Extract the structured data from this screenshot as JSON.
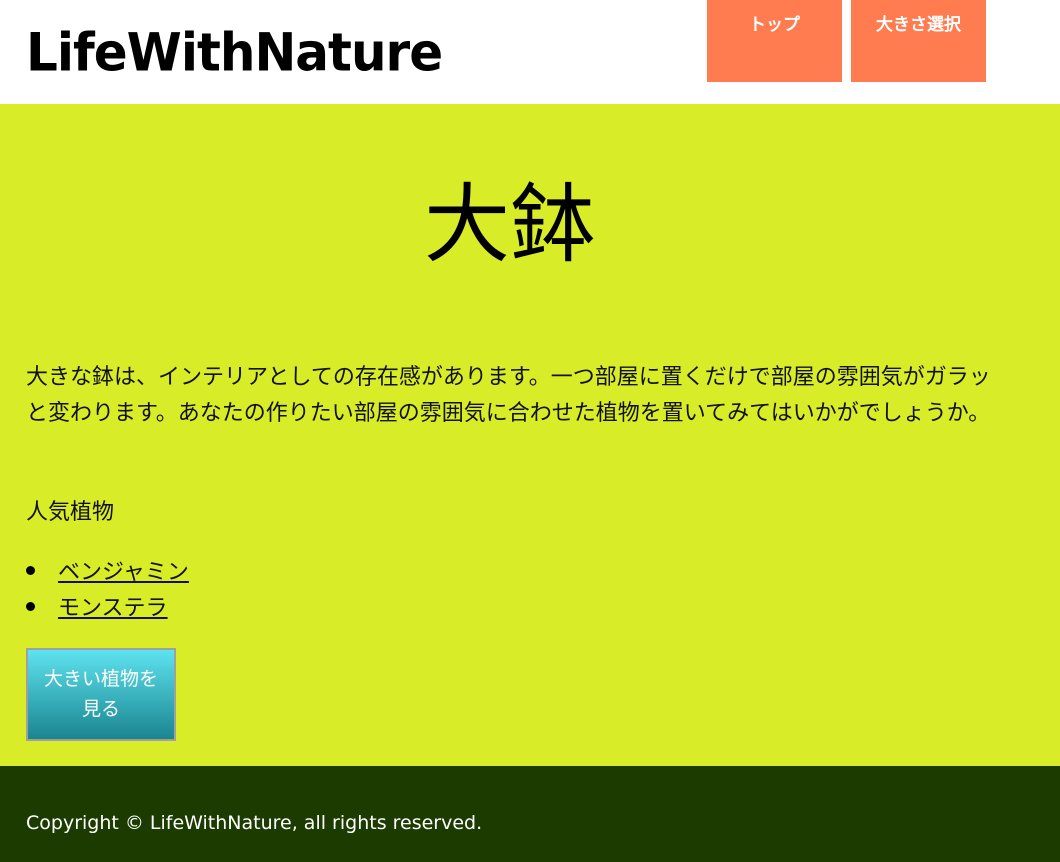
{
  "header": {
    "logo": "LifeWithNature",
    "nav": [
      {
        "label": "トップ"
      },
      {
        "label": "大きさ選択"
      }
    ]
  },
  "main": {
    "title": "大鉢",
    "description": "大きな鉢は、インテリアとしての存在感があります。一つ部屋に置くだけで部屋の雰囲気がガラッと変わります。あなたの作りたい部屋の雰囲気に合わせた植物を置いてみてはいかがでしょうか。",
    "popular_label": "人気植物",
    "plants": [
      {
        "name": "ベンジャミン"
      },
      {
        "name": "モンステラ"
      }
    ],
    "cta_label": "大きい植物を見る"
  },
  "footer": {
    "copyright": "Copyright © LifeWithNature, all rights reserved."
  },
  "colors": {
    "main_bg": "#d9ec28",
    "nav_bg": "#ff7b50",
    "footer_bg": "#1b3b00",
    "cta_top": "#5ee3ef",
    "cta_bottom": "#1a8590"
  }
}
